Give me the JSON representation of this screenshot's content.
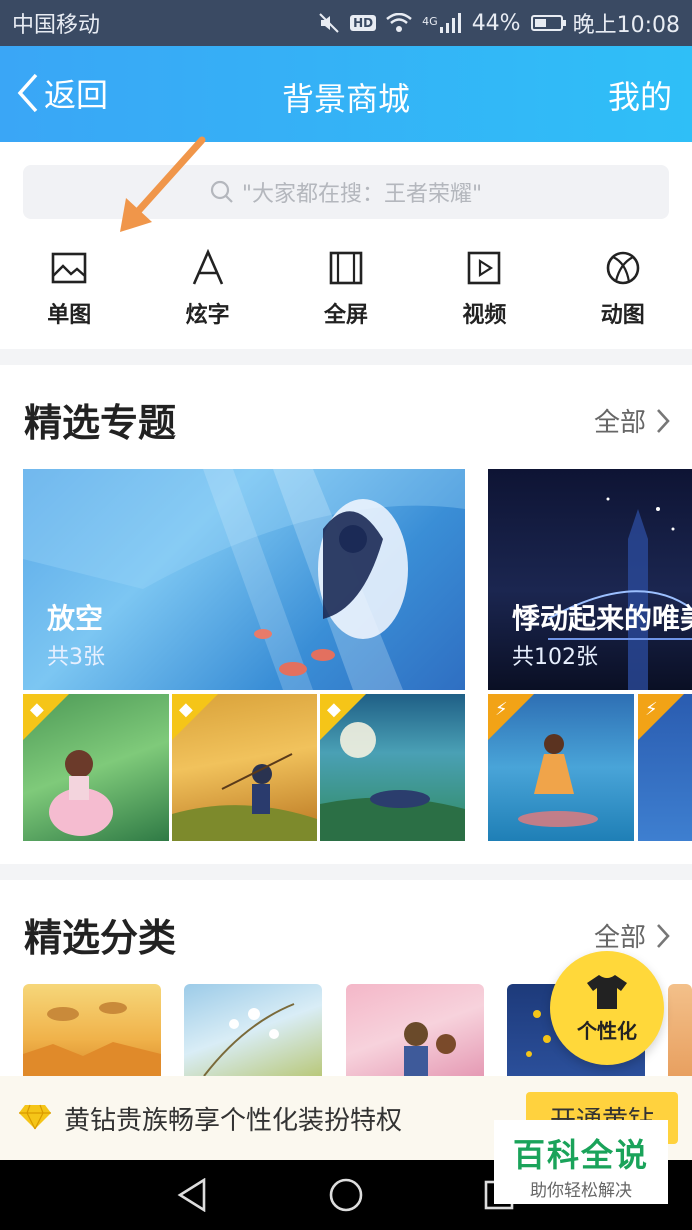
{
  "status": {
    "carrier": "中国移动",
    "network": "4G",
    "battery": "44%",
    "battery_level": 0.44,
    "time": "晚上10:08",
    "hd": "HD"
  },
  "header": {
    "back": "返回",
    "title": "背景商城",
    "mine": "我的"
  },
  "search": {
    "placeholder": "\"大家都在搜：王者荣耀\""
  },
  "categories": [
    {
      "label": "单图",
      "icon": "image-icon"
    },
    {
      "label": "炫字",
      "icon": "letter-a-icon"
    },
    {
      "label": "全屏",
      "icon": "fullscreen-icon"
    },
    {
      "label": "视频",
      "icon": "video-play-icon"
    },
    {
      "label": "动图",
      "icon": "ball-icon"
    }
  ],
  "featured": {
    "title": "精选专题",
    "all": "全部",
    "topics": [
      {
        "name": "放空",
        "count": "共3张"
      },
      {
        "name": "悸动起来的唯美",
        "count": "共102张"
      }
    ]
  },
  "classify": {
    "title": "精选分类",
    "all": "全部"
  },
  "fab": {
    "label": "个性化",
    "icon": "tshirt-icon"
  },
  "vip": {
    "text": "黄钻贵族畅享个性化装扮特权",
    "button": "开通黄钻"
  },
  "watermark": {
    "title": "百科全说",
    "subtitle": "助你轻松解决"
  },
  "colors": {
    "header": "#36b1f7",
    "accent_yellow": "#ffd83a",
    "status_bar": "#3a4a63"
  }
}
